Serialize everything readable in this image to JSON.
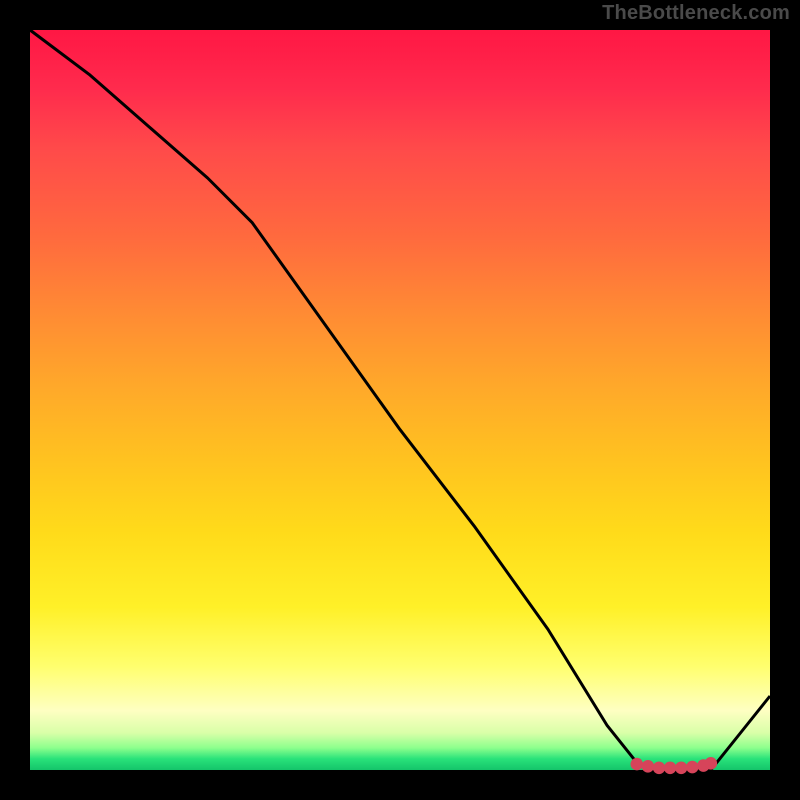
{
  "watermark": "TheBottleneck.com",
  "chart_data": {
    "type": "line",
    "title": "",
    "xlabel": "",
    "ylabel": "",
    "xlim": [
      0,
      100
    ],
    "ylim": [
      0,
      100
    ],
    "grid": false,
    "legend": false,
    "curve": {
      "x": [
        0,
        8,
        16,
        24,
        30,
        40,
        50,
        60,
        70,
        78,
        82,
        85,
        88,
        90,
        92,
        96,
        100
      ],
      "y": [
        100,
        94,
        87,
        80,
        74,
        60,
        46,
        33,
        19,
        6,
        1,
        0,
        0,
        0,
        0,
        5,
        10
      ]
    },
    "markers": {
      "x": [
        82,
        83.5,
        85,
        86.5,
        88,
        89.5,
        91,
        92
      ],
      "y": [
        0.8,
        0.5,
        0.3,
        0.3,
        0.3,
        0.4,
        0.6,
        0.9
      ]
    }
  }
}
